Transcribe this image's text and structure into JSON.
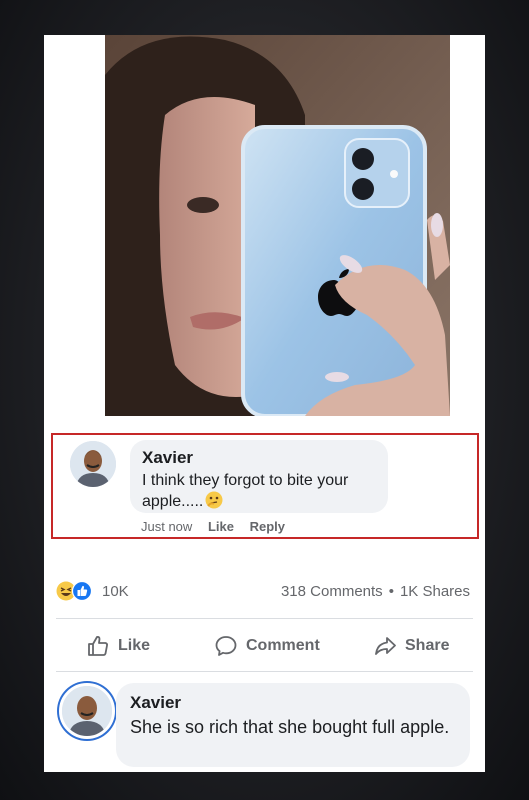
{
  "post": {
    "photo_icon": "apple-logo-icon"
  },
  "highlighted_comment": {
    "name": "Xavier",
    "text": "I think they forgot to bite your apple.....",
    "emoji": "thinking-face-icon",
    "time": "Just now",
    "like": "Like",
    "reply": "Reply",
    "highlight_color": "#c62828"
  },
  "reactions": {
    "count": "10K",
    "icons": [
      "laughing-face-icon",
      "like-thumb-icon"
    ]
  },
  "stats": {
    "comments": "318 Comments",
    "separator": "•",
    "shares": "1K Shares"
  },
  "actions": {
    "like": "Like",
    "comment": "Comment",
    "share": "Share"
  },
  "bottom_comment": {
    "name": "Xavier",
    "text": "She is so rich that she bought full apple."
  },
  "colors": {
    "bubble": "#f0f2f5",
    "muted_text": "#65676b",
    "like_blue": "#1877f2"
  }
}
